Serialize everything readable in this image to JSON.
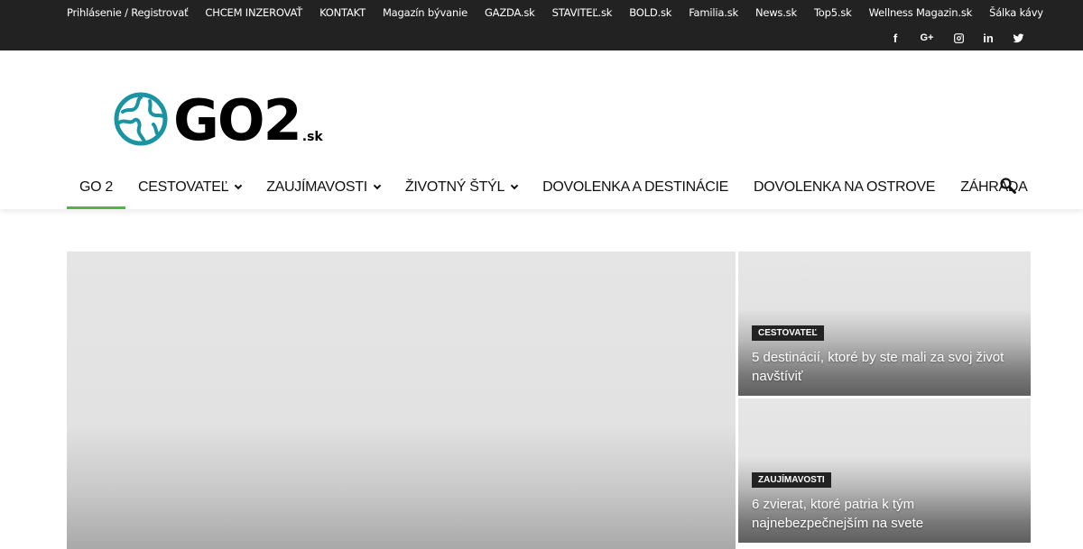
{
  "topbar": {
    "links": [
      "Prihlásenie / Registrovať",
      "CHCEM INZEROVAŤ",
      "KONTAKT",
      "Magazín bývanie",
      "GAZDA.sk",
      "STAVITEĽ.sk",
      "BOLD.sk",
      "Familia.sk",
      "News.sk",
      "Top5.sk",
      "Wellness Magazin.sk",
      "Šálka kávy"
    ],
    "social": [
      "facebook-icon",
      "google-plus-icon",
      "instagram-icon",
      "linkedin-icon",
      "twitter-icon"
    ],
    "social_labels": {
      "facebook": "f",
      "google_plus": "G+",
      "linkedin": "in"
    }
  },
  "logo": {
    "word": "GO2",
    "tld": ".sk",
    "accent": "#1a93a3"
  },
  "nav": {
    "items": [
      {
        "label": "GO 2",
        "dropdown": false,
        "active": true
      },
      {
        "label": "CESTOVATEĽ",
        "dropdown": true,
        "active": false
      },
      {
        "label": "ZAUJÍMAVOSTI",
        "dropdown": true,
        "active": false
      },
      {
        "label": "ŽIVOTNÝ ŠTÝL",
        "dropdown": true,
        "active": false
      },
      {
        "label": "DOVOLENKA A DESTINÁCIE",
        "dropdown": false,
        "active": false
      },
      {
        "label": "DOVOLENKA NA OSTROVE",
        "dropdown": false,
        "active": false
      },
      {
        "label": "ZÁHRADA",
        "dropdown": false,
        "active": false
      }
    ],
    "active_color": "#4db748"
  },
  "featured": {
    "tiles": [
      {
        "category": "CESTOVATEĽ",
        "title": "5 destinácií, ktoré by ste mali za svoj život navštíviť"
      },
      {
        "category": "ZAUJÍMAVOSTI",
        "title": "6 zvierat, ktoré patria k tým najnebezpečnejším na svete"
      }
    ]
  }
}
